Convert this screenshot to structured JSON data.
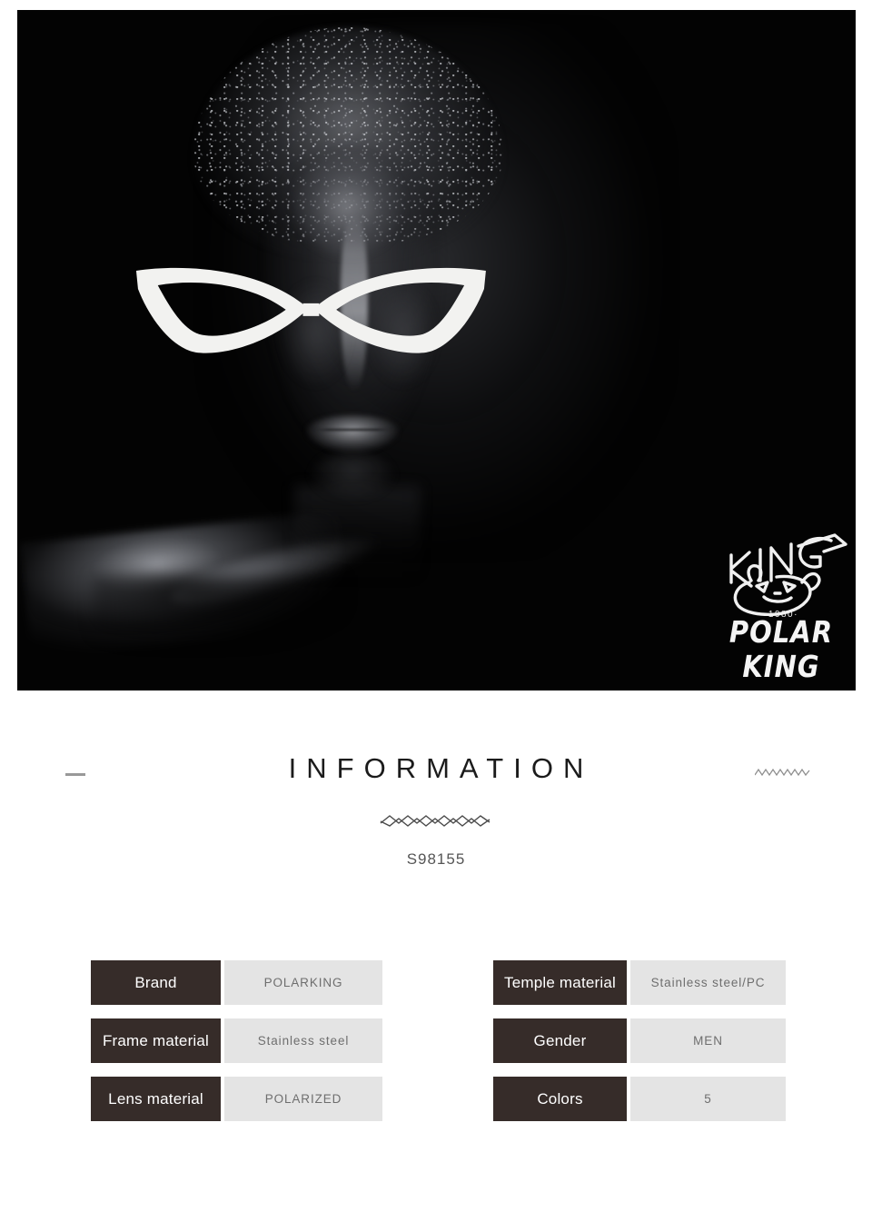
{
  "hero": {
    "alt_description": "Woman in dark portrait wearing white cat-eye sunglasses",
    "background_color": "#000000",
    "logo": {
      "mark_name": "polar-bear-king-logo",
      "year": "·1980·",
      "wordmark": "POLAR KING"
    }
  },
  "information": {
    "heading": "INFORMATION",
    "model_code": "S98155",
    "ornament_left": "dash-rule",
    "ornament_right": "zigzag-rule",
    "ornament_center": "zigzag-divider"
  },
  "specs": {
    "left_column": [
      {
        "label": "Brand",
        "value": "POLARKING"
      },
      {
        "label": "Frame material",
        "value": "Stainless steel"
      },
      {
        "label": "Lens material",
        "value": "POLARIZED"
      }
    ],
    "right_column": [
      {
        "label": "Temple material",
        "value": "Stainless steel/PC"
      },
      {
        "label": "Gender",
        "value": "MEN"
      },
      {
        "label": "Colors",
        "value": "5"
      }
    ]
  },
  "colors": {
    "label_bg": "#362c29",
    "label_text": "#ffffff",
    "value_bg": "#e4e4e4",
    "value_text": "#6e6e6e",
    "page_bg": "#ffffff",
    "heading_text": "#1b1b1b",
    "ornament": "#999999"
  }
}
